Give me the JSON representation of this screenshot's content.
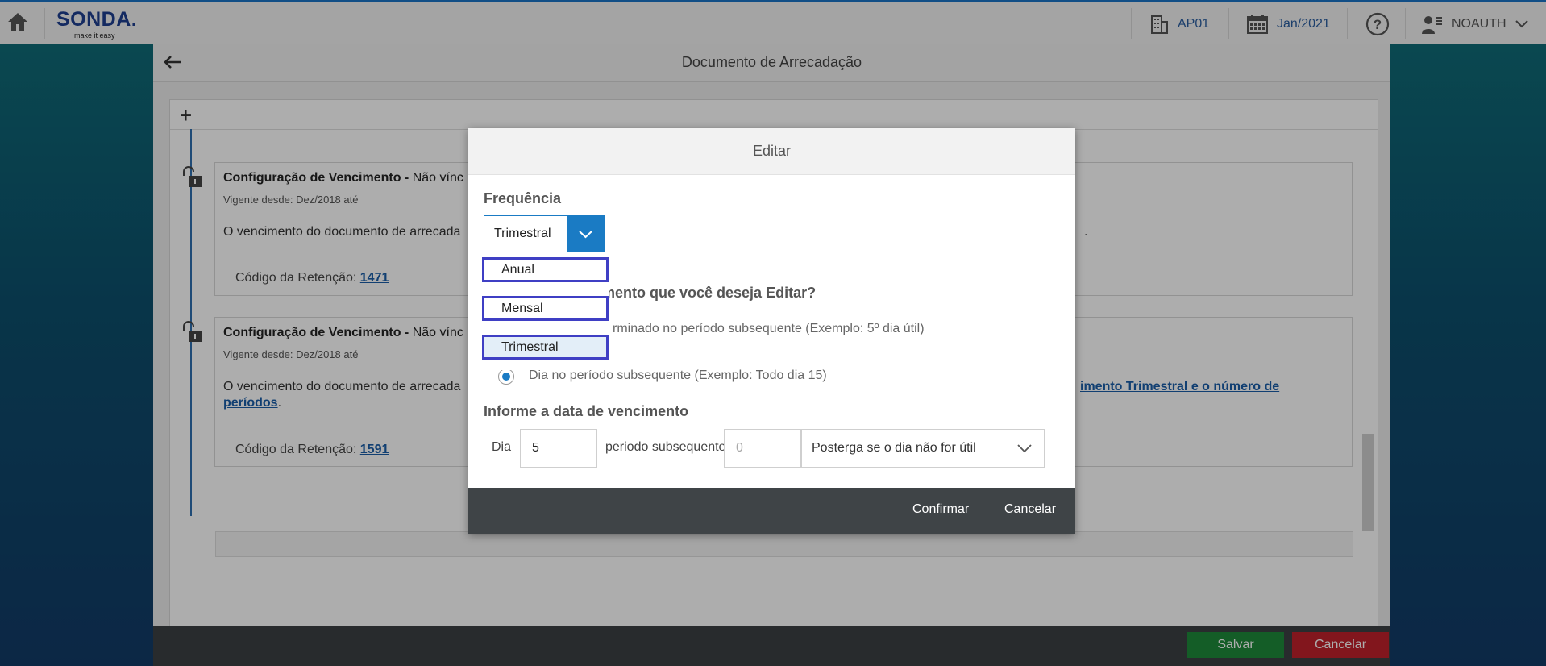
{
  "header": {
    "logo_main": "SONDA.",
    "logo_tag": "make it easy",
    "company": "AP01",
    "period": "Jan/2021",
    "user": "NOAUTH"
  },
  "page": {
    "title": "Documento de Arrecadação",
    "add_label": "+"
  },
  "cards": [
    {
      "title_bold": "Configuração de Vencimento -",
      "title_rest": " Não vínc",
      "since": "Vigente desde: Dez/2018 até",
      "text": "O vencimento do documento de arrecada",
      "text_tail": ".",
      "code_label": "Código da Retenção: ",
      "code": "1471"
    },
    {
      "title_bold": "Configuração de Vencimento -",
      "title_rest": " Não vínc",
      "since": "Vigente desde: Dez/2018 até",
      "text": "O vencimento do documento de arrecada",
      "link_tail": "imento Trimestral e o número de",
      "link_line2": "períodos",
      "text_end": ".",
      "code_label": "Código da Retenção: ",
      "code": "1591"
    }
  ],
  "footer": {
    "save": "Salvar",
    "cancel": "Cancelar"
  },
  "modal": {
    "title": "Editar",
    "freq_label": "Frequência",
    "freq_value": "Trimestral",
    "options": [
      "Anual",
      "Mensal",
      "Trimestral"
    ],
    "selected_option": "Trimestral",
    "question_tail": "mento que você deseja Editar?",
    "radio1_tail": "rminado no período subsequente (Exemplo: 5º dia útil)",
    "radio2": "Dia no período subsequente (Exemplo: Todo dia 15)",
    "due_label": "Informe a data de vencimento",
    "dia_label": "Dia",
    "dia_value": "5",
    "periodo_label": "periodo subsequente",
    "periodo_placeholder": "0",
    "posterga": "Posterga se o dia não for útil",
    "confirm": "Confirmar",
    "cancel": "Cancelar"
  },
  "colors": {
    "accent": "#1a7bc4",
    "highlight_border": "#3f3fc4",
    "save": "#1e8a3a",
    "cancel": "#c0212b"
  }
}
